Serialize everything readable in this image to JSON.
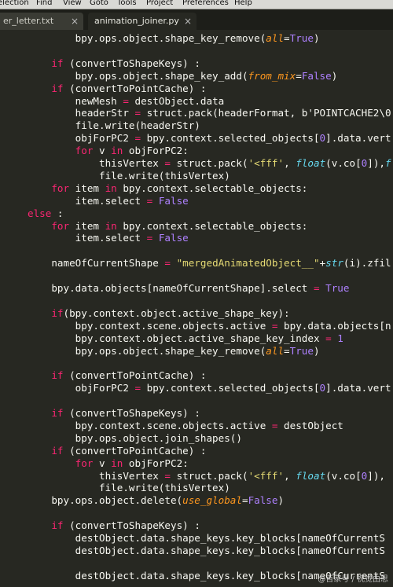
{
  "menu": [
    "election",
    "Find",
    "View",
    "Goto",
    "Tools",
    "Project",
    "Preferences",
    "Help"
  ],
  "tabs": [
    {
      "label": "er_letter.txt",
      "close": "×",
      "active": false
    },
    {
      "label": "animation_joiner.py",
      "close": "×",
      "active": true
    }
  ],
  "code_lines": [
    [
      [
        "        bpy.ops.object.shape_key_remove(",
        ""
      ],
      [
        "all",
        "prm"
      ],
      [
        "=",
        ""
      ],
      [
        "True",
        "num"
      ],
      [
        ")",
        ""
      ]
    ],
    [
      [
        "",
        ""
      ]
    ],
    [
      [
        "    ",
        ""
      ],
      [
        "if",
        "kw"
      ],
      [
        " (convertToShapeKeys) :",
        ""
      ]
    ],
    [
      [
        "        bpy.ops.object.shape_key_add(",
        ""
      ],
      [
        "from_mix",
        "prm"
      ],
      [
        "=",
        ""
      ],
      [
        "False",
        "num"
      ],
      [
        ")",
        ""
      ]
    ],
    [
      [
        "    ",
        ""
      ],
      [
        "if",
        "kw"
      ],
      [
        " (convertToPointCache) :",
        ""
      ]
    ],
    [
      [
        "        newMesh ",
        ""
      ],
      [
        "=",
        "kw"
      ],
      [
        " destObject.data",
        ""
      ]
    ],
    [
      [
        "        headerStr ",
        ""
      ],
      [
        "=",
        "kw"
      ],
      [
        " struct.pack(headerFormat, b",
        ""
      ],
      [
        "'POINTCACHE2\\0",
        ""
      ]
    ],
    [
      [
        "        file.write(headerStr)",
        ""
      ]
    ],
    [
      [
        "        objForPC2 ",
        ""
      ],
      [
        "=",
        "kw"
      ],
      [
        " bpy.context.selected_objects[",
        ""
      ],
      [
        "0",
        "num"
      ],
      [
        "].data.vert",
        ""
      ]
    ],
    [
      [
        "        ",
        ""
      ],
      [
        "for",
        "kw"
      ],
      [
        " v ",
        ""
      ],
      [
        "in",
        "kw"
      ],
      [
        " objForPC2:",
        ""
      ]
    ],
    [
      [
        "            thisVertex ",
        ""
      ],
      [
        "=",
        "kw"
      ],
      [
        " struct.pack(",
        ""
      ],
      [
        "'<fff'",
        "str"
      ],
      [
        ", ",
        ""
      ],
      [
        "float",
        "fn"
      ],
      [
        "(v.co[",
        ""
      ],
      [
        "0",
        "num"
      ],
      [
        "]),",
        ""
      ],
      [
        "f",
        "fn"
      ]
    ],
    [
      [
        "            file.write(thisVertex)",
        ""
      ]
    ],
    [
      [
        "    ",
        ""
      ],
      [
        "for",
        "kw"
      ],
      [
        " item ",
        ""
      ],
      [
        "in",
        "kw"
      ],
      [
        " bpy.context.selectable_objects:",
        ""
      ]
    ],
    [
      [
        "        item.select ",
        ""
      ],
      [
        "=",
        "kw"
      ],
      [
        " ",
        ""
      ],
      [
        "False",
        "num"
      ]
    ],
    [
      [
        "else",
        "kw"
      ],
      [
        " :",
        ""
      ]
    ],
    [
      [
        "    ",
        ""
      ],
      [
        "for",
        "kw"
      ],
      [
        " item ",
        ""
      ],
      [
        "in",
        "kw"
      ],
      [
        " bpy.context.selectable_objects:",
        ""
      ]
    ],
    [
      [
        "        item.select ",
        ""
      ],
      [
        "=",
        "kw"
      ],
      [
        " ",
        ""
      ],
      [
        "False",
        "num"
      ]
    ],
    [
      [
        "",
        ""
      ]
    ],
    [
      [
        "    nameOfCurrentShape ",
        ""
      ],
      [
        "=",
        "kw"
      ],
      [
        " ",
        ""
      ],
      [
        "\"mergedAnimatedObject__\"",
        "str"
      ],
      [
        "+",
        ""
      ],
      [
        "str",
        "fn"
      ],
      [
        "(i).zfil",
        ""
      ]
    ],
    [
      [
        "",
        ""
      ]
    ],
    [
      [
        "    bpy.data.objects[nameOfCurrentShape].select ",
        ""
      ],
      [
        "=",
        "kw"
      ],
      [
        " ",
        ""
      ],
      [
        "True",
        "num"
      ]
    ],
    [
      [
        "",
        ""
      ]
    ],
    [
      [
        "    ",
        ""
      ],
      [
        "if",
        "kw"
      ],
      [
        "(bpy.context.object.active_shape_key):",
        ""
      ]
    ],
    [
      [
        "        bpy.context.scene.objects.active ",
        ""
      ],
      [
        "=",
        "kw"
      ],
      [
        " bpy.data.objects[n",
        ""
      ]
    ],
    [
      [
        "        bpy.context.object.active_shape_key_index ",
        ""
      ],
      [
        "=",
        "kw"
      ],
      [
        " ",
        ""
      ],
      [
        "1",
        "num"
      ]
    ],
    [
      [
        "        bpy.ops.object.shape_key_remove(",
        ""
      ],
      [
        "all",
        "prm"
      ],
      [
        "=",
        ""
      ],
      [
        "True",
        "num"
      ],
      [
        ")",
        ""
      ]
    ],
    [
      [
        "",
        ""
      ]
    ],
    [
      [
        "    ",
        ""
      ],
      [
        "if",
        "kw"
      ],
      [
        " (convertToPointCache) :",
        ""
      ]
    ],
    [
      [
        "        objForPC2 ",
        ""
      ],
      [
        "=",
        "kw"
      ],
      [
        " bpy.context.selected_objects[",
        ""
      ],
      [
        "0",
        "num"
      ],
      [
        "].data.vert",
        ""
      ]
    ],
    [
      [
        "",
        ""
      ]
    ],
    [
      [
        "    ",
        ""
      ],
      [
        "if",
        "kw"
      ],
      [
        " (convertToShapeKeys) :",
        ""
      ]
    ],
    [
      [
        "        bpy.context.scene.objects.active ",
        ""
      ],
      [
        "=",
        "kw"
      ],
      [
        " destObject",
        ""
      ]
    ],
    [
      [
        "        bpy.ops.object.join_shapes()",
        ""
      ]
    ],
    [
      [
        "    ",
        ""
      ],
      [
        "if",
        "kw"
      ],
      [
        " (convertToPointCache) :",
        ""
      ]
    ],
    [
      [
        "        ",
        ""
      ],
      [
        "for",
        "kw"
      ],
      [
        " v ",
        ""
      ],
      [
        "in",
        "kw"
      ],
      [
        " objForPC2:",
        ""
      ]
    ],
    [
      [
        "            thisVertex ",
        ""
      ],
      [
        "=",
        "kw"
      ],
      [
        " struct.pack(",
        ""
      ],
      [
        "'<fff'",
        "str"
      ],
      [
        ", ",
        ""
      ],
      [
        "float",
        "fn"
      ],
      [
        "(v.co[",
        ""
      ],
      [
        "0",
        "num"
      ],
      [
        "]),",
        ""
      ]
    ],
    [
      [
        "            file.write(thisVertex)",
        ""
      ]
    ],
    [
      [
        "    bpy.ops.object.delete(",
        ""
      ],
      [
        "use_global",
        "prm"
      ],
      [
        "=",
        ""
      ],
      [
        "False",
        "num"
      ],
      [
        ")",
        ""
      ]
    ],
    [
      [
        "",
        ""
      ]
    ],
    [
      [
        "    ",
        ""
      ],
      [
        "if",
        "kw"
      ],
      [
        " (convertToShapeKeys) :",
        ""
      ]
    ],
    [
      [
        "        destObject.data.shape_keys.key_blocks[nameOfCurrentS",
        ""
      ]
    ],
    [
      [
        "        destObject.data.shape_keys.key_blocks[nameOfCurrentS",
        ""
      ]
    ],
    [
      [
        "",
        ""
      ]
    ],
    [
      [
        "        destObject.data.shape_keys.key_blocks[nameOfCurrentS",
        ""
      ]
    ]
  ],
  "watermark": "@百家号 / 祝觉由思"
}
